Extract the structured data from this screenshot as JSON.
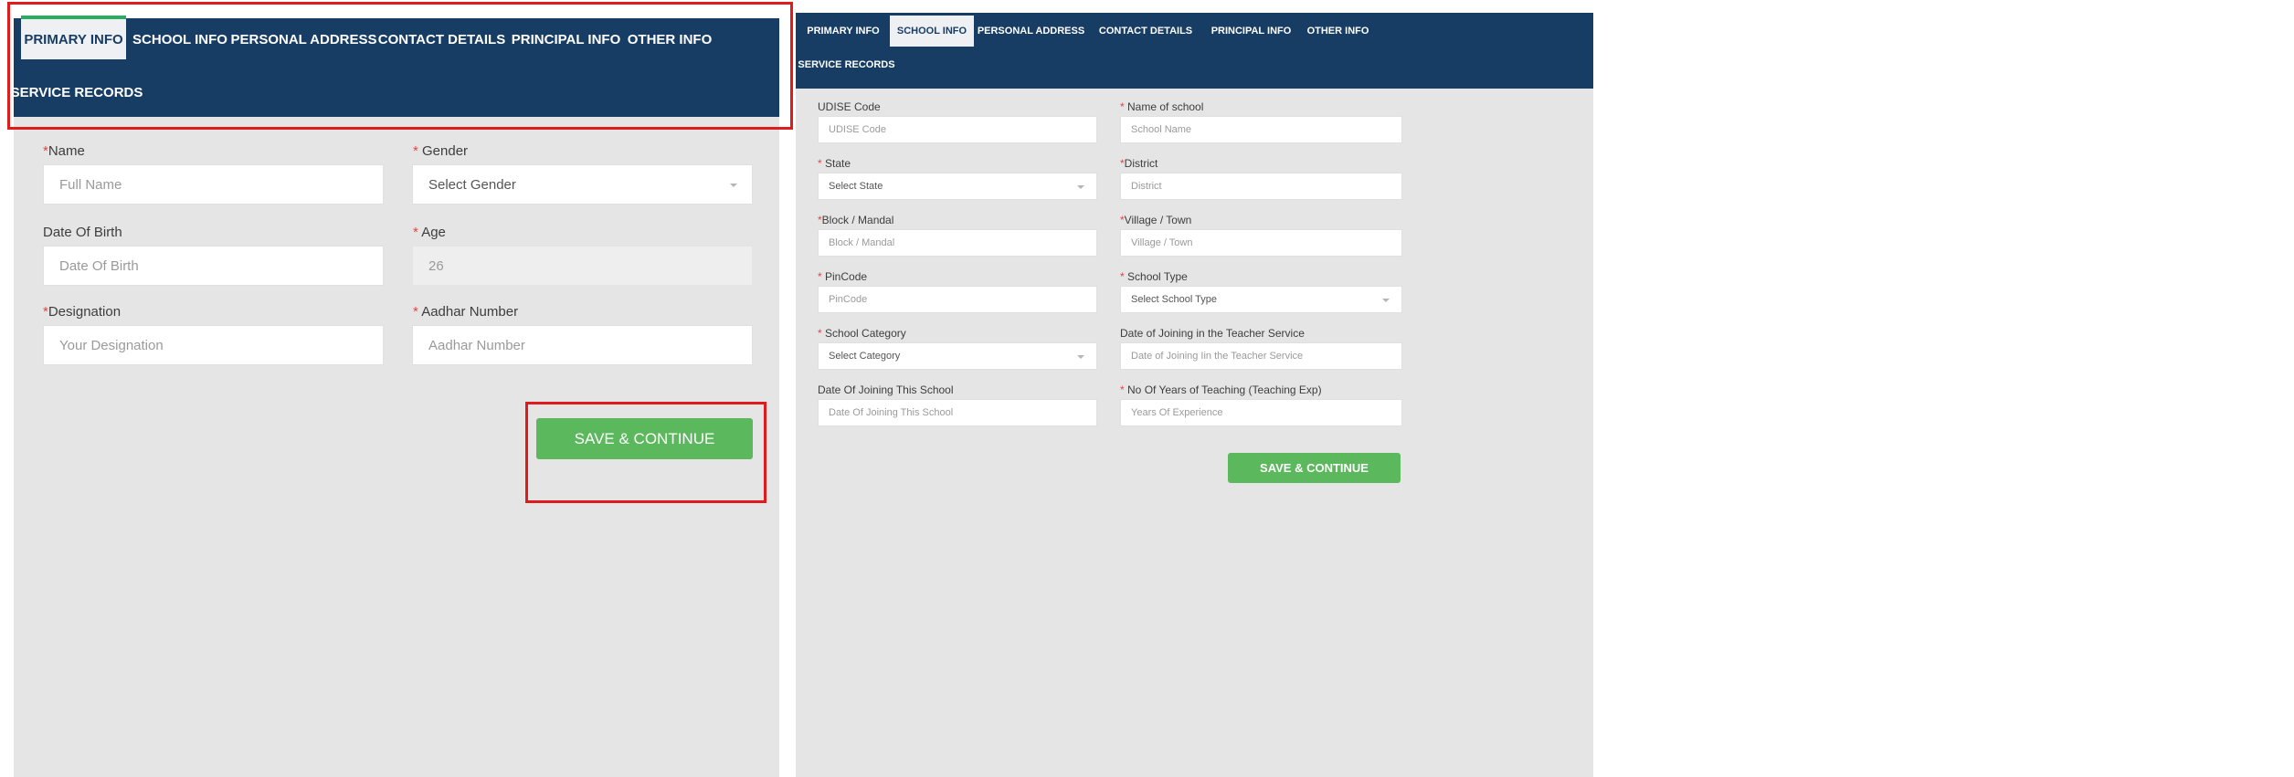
{
  "left_form": {
    "tabs": [
      "PRIMARY INFO",
      "SCHOOL INFO",
      "PERSONAL ADDRESS",
      "CONTACT DETAILS",
      "PRINCIPAL INFO",
      "OTHER INFO",
      "SERVICE RECORDS"
    ],
    "fields": {
      "name": {
        "label": "Name",
        "required": "*",
        "placeholder": "Full Name"
      },
      "gender": {
        "label": "Gender",
        "required": "*",
        "value": "Select Gender"
      },
      "dob": {
        "label": "Date Of Birth",
        "placeholder": "Date Of Birth"
      },
      "age": {
        "label": "Age",
        "required": "*",
        "value": "26"
      },
      "designation": {
        "label": "Designation",
        "required": "*",
        "placeholder": "Your Designation"
      },
      "aadhar": {
        "label": "Aadhar Number",
        "required": "*",
        "placeholder": "Aadhar Number"
      }
    },
    "save_label": "SAVE & CONTINUE"
  },
  "right_form": {
    "tabs": [
      "PRIMARY INFO",
      "SCHOOL INFO",
      "PERSONAL ADDRESS",
      "CONTACT DETAILS",
      "PRINCIPAL INFO",
      "OTHER INFO",
      "SERVICE RECORDS"
    ],
    "fields": {
      "udise": {
        "label": "UDISE Code",
        "placeholder": "UDISE Code"
      },
      "school_name": {
        "label": "Name of school",
        "required": "*",
        "placeholder": "School Name"
      },
      "state": {
        "label": "State",
        "required": "*",
        "value": "Select State"
      },
      "district": {
        "label": "District",
        "required": "*",
        "placeholder": "District"
      },
      "block": {
        "label": "Block / Mandal",
        "required": "*",
        "placeholder": "Block / Mandal"
      },
      "village": {
        "label": "Village / Town",
        "required": "*",
        "placeholder": "Village / Town"
      },
      "pincode": {
        "label": "PinCode",
        "required": "*",
        "placeholder": "PinCode"
      },
      "school_type": {
        "label": "School Type",
        "required": "*",
        "value": "Select School Type"
      },
      "school_category": {
        "label": "School Category",
        "required": "*",
        "value": "Select Category"
      },
      "doj_service": {
        "label": "Date of Joining in the Teacher Service",
        "placeholder": "Date of Joining Iin the Teacher Service"
      },
      "doj_school": {
        "label": "Date Of Joining This School",
        "placeholder": "Date Of Joining This School"
      },
      "years_teaching": {
        "label": "No Of Years of Teaching (Teaching Exp)",
        "required": "*",
        "placeholder": "Years Of Experience"
      }
    },
    "save_label": "SAVE & CONTINUE"
  },
  "colors": {
    "header": "#173d64",
    "active_tab_bg": "#eff0f4",
    "active_indicator": "#27ae60",
    "required": "#e04545",
    "save_button": "#5cb85c",
    "highlight": "#e11b1b"
  }
}
